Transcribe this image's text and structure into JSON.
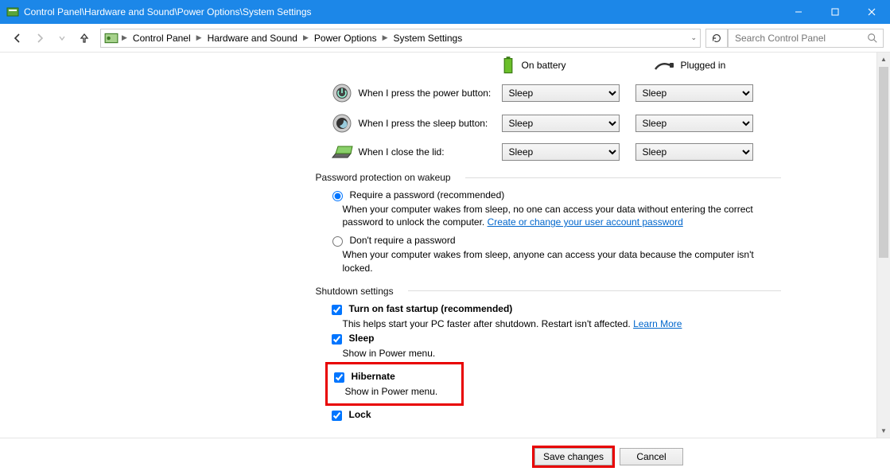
{
  "title": "Control Panel\\Hardware and Sound\\Power Options\\System Settings",
  "breadcrumb": [
    "Control Panel",
    "Hardware and Sound",
    "Power Options",
    "System Settings"
  ],
  "search_placeholder": "Search Control Panel",
  "columns": {
    "battery": "On battery",
    "plugged": "Plugged in"
  },
  "rows": {
    "power": {
      "label": "When I press the power button:",
      "battery": "Sleep",
      "plugged": "Sleep"
    },
    "sleep": {
      "label": "When I press the sleep button:",
      "battery": "Sleep",
      "plugged": "Sleep"
    },
    "lid": {
      "label": "When I close the lid:",
      "battery": "Sleep",
      "plugged": "Sleep"
    }
  },
  "password_section": "Password protection on wakeup",
  "radio_require": {
    "label": "Require a password (recommended)",
    "desc_pre": "When your computer wakes from sleep, no one can access your data without entering the correct password to unlock the computer. ",
    "link": "Create or change your user account password"
  },
  "radio_dont": {
    "label": "Don't require a password",
    "desc": "When your computer wakes from sleep, anyone can access your data because the computer isn't locked."
  },
  "shutdown_section": "Shutdown settings",
  "fast_startup": {
    "label": "Turn on fast startup (recommended)",
    "desc_pre": "This helps start your PC faster after shutdown. Restart isn't affected. ",
    "link": "Learn More"
  },
  "sleep_opt": {
    "label": "Sleep",
    "desc": "Show in Power menu."
  },
  "hibernate_opt": {
    "label": "Hibernate",
    "desc": "Show in Power menu."
  },
  "lock_opt": {
    "label": "Lock"
  },
  "buttons": {
    "save": "Save changes",
    "cancel": "Cancel"
  }
}
